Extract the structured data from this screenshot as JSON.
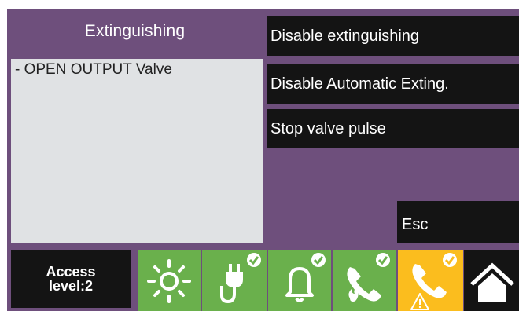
{
  "header": {
    "title": "Extinguishing"
  },
  "info": {
    "message": "- OPEN OUTPUT Valve"
  },
  "commands": {
    "disable_extinguishing": "Disable extinguishing",
    "disable_automatic": "Disable Automatic Exting.",
    "stop_valve_pulse": "Stop valve pulse",
    "esc": "Esc"
  },
  "status_bar": {
    "access_line1": "Access",
    "access_line2": "level:2",
    "tiles": [
      {
        "icon": "sun-icon",
        "state": "ok"
      },
      {
        "icon": "power-plug-icon",
        "state": "ok"
      },
      {
        "icon": "bell-icon",
        "state": "ok"
      },
      {
        "icon": "phone-fire-icon",
        "state": "ok"
      },
      {
        "icon": "phone-warning-icon",
        "state": "warning"
      },
      {
        "icon": "home-icon",
        "state": "neutral"
      }
    ]
  },
  "colors": {
    "panel_purple": "#6e4f7c",
    "button_black": "#141414",
    "info_gray": "#e0e2e4",
    "ok_green": "#6ab04c",
    "warning_yellow": "#fbbd1e"
  }
}
